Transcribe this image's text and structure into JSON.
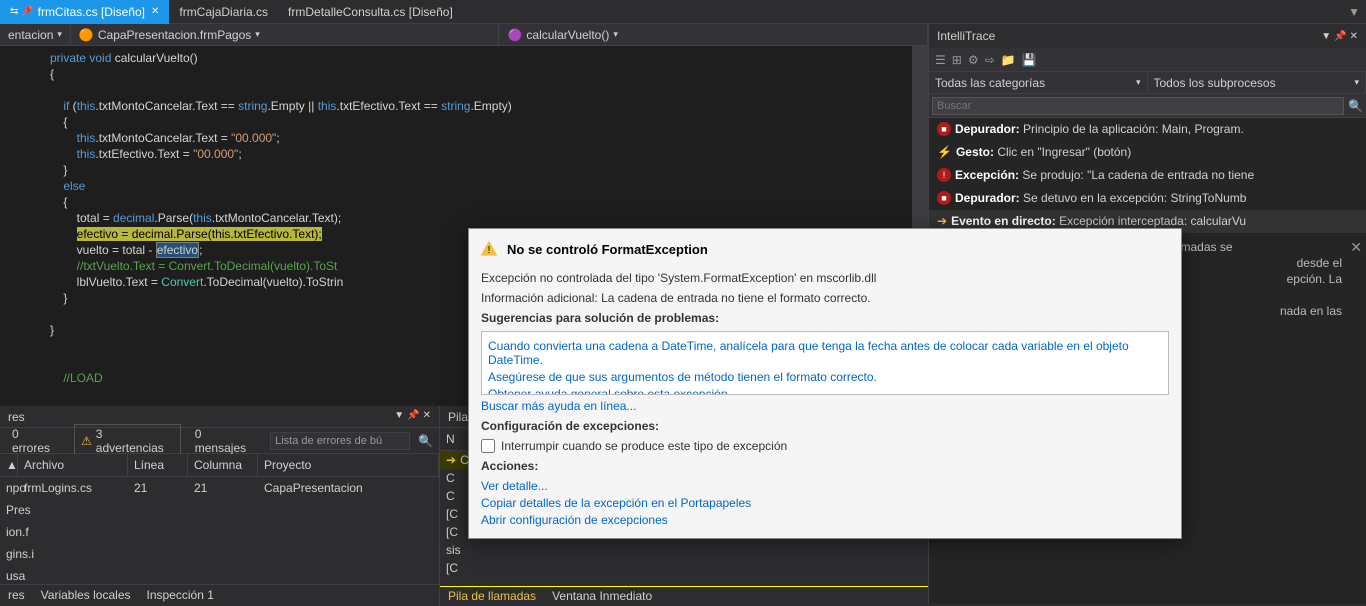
{
  "tabs": [
    {
      "label": "frmCitas.cs [Diseño]",
      "active": true,
      "pinned": true,
      "closeable": true
    },
    {
      "label": "frmCajaDiaria.cs",
      "active": false
    },
    {
      "label": "frmDetalleConsulta.cs [Diseño]",
      "active": false
    }
  ],
  "breadcrumb": {
    "left": "entacion",
    "namespace": "CapaPresentacion.frmPagos",
    "method": "calcularVuelto()"
  },
  "code": {
    "sig": "private void calcularVuelto()",
    "empty": "Empty",
    "str_zero": "\"00.000\"",
    "comment1": "//txtVuelto.Text = Convert.ToDecimal(vuelto).ToSt",
    "load": "//LOAD",
    "eff": "efectivo"
  },
  "errlist": {
    "title": "res",
    "errors": "0 errores",
    "warnings": "3 advertencias",
    "messages": "0 mensajes",
    "search_ph": "Lista de errores de bú",
    "cols": {
      "file": "Archivo",
      "line": "Línea",
      "col": "Columna",
      "proj": "Proyecto"
    },
    "rows": [
      {
        "file": "frmLogins.cs",
        "line": "21",
        "col": "21",
        "proj": "CapaPresentacion"
      }
    ],
    "trunc": [
      "npo",
      "Pres",
      "ion.f",
      "gins.i",
      "usa"
    ]
  },
  "callstack": {
    "title": "Pila d",
    "col": "N",
    "rows": [
      "C",
      "C",
      "C",
      "[C",
      "[C",
      "sis",
      "[C"
    ]
  },
  "bottom_tabs1": [
    "res",
    "Variables locales",
    "Inspección 1"
  ],
  "bottom_tabs2": [
    "Pila de llamadas",
    "Ventana Inmediato"
  ],
  "intellitrace": {
    "title": "IntelliTrace",
    "filter1": "Todas las categorías",
    "filter2": "Todos los subprocesos",
    "search_ph": "Buscar",
    "events": [
      {
        "type": "red",
        "label": "Depurador:",
        "text": "Principio de la aplicación: Main, Program."
      },
      {
        "type": "bolt",
        "label": "Gesto:",
        "text": "Clic en \"Ingresar\" (botón)"
      },
      {
        "type": "red",
        "label": "Excepción:",
        "text": "Se produjo: \"La cadena de entrada no tiene"
      },
      {
        "type": "red",
        "label": "Depurador:",
        "text": "Se detuvo en la excepción: StringToNumb"
      },
      {
        "type": "arrow",
        "label": "Evento en directo:",
        "text": "Excepción interceptada: calcularVu"
      }
    ],
    "detail": "Se interceptó una excepción y la pila de llamadas se",
    "detail_frags": [
      "desde el",
      "epción. La",
      "nada en las"
    ]
  },
  "exception": {
    "title": "No se controló FormatException",
    "body1": "Excepción no controlada del tipo 'System.FormatException' en mscorlib.dll",
    "body2": "Información adicional: La cadena de entrada no tiene el formato correcto.",
    "sug_title": "Sugerencias para solución de problemas:",
    "sug1": "Cuando convierta una cadena a DateTime, analícela para que tenga la fecha antes de colocar cada variable en el objeto DateTime.",
    "sug2": "Asegúrese de que sus argumentos de método tienen el formato correcto.",
    "sug3": "Obtener ayuda general sobre esta excepción.",
    "more": "Buscar más ayuda en línea...",
    "cfg_title": "Configuración de excepciones:",
    "chk": "Interrumpir cuando se produce este tipo de excepción",
    "act_title": "Acciones:",
    "act1": "Ver detalle...",
    "act2": "Copiar detalles de la excepción en el Portapapeles",
    "act3": "Abrir configuración de excepciones"
  }
}
